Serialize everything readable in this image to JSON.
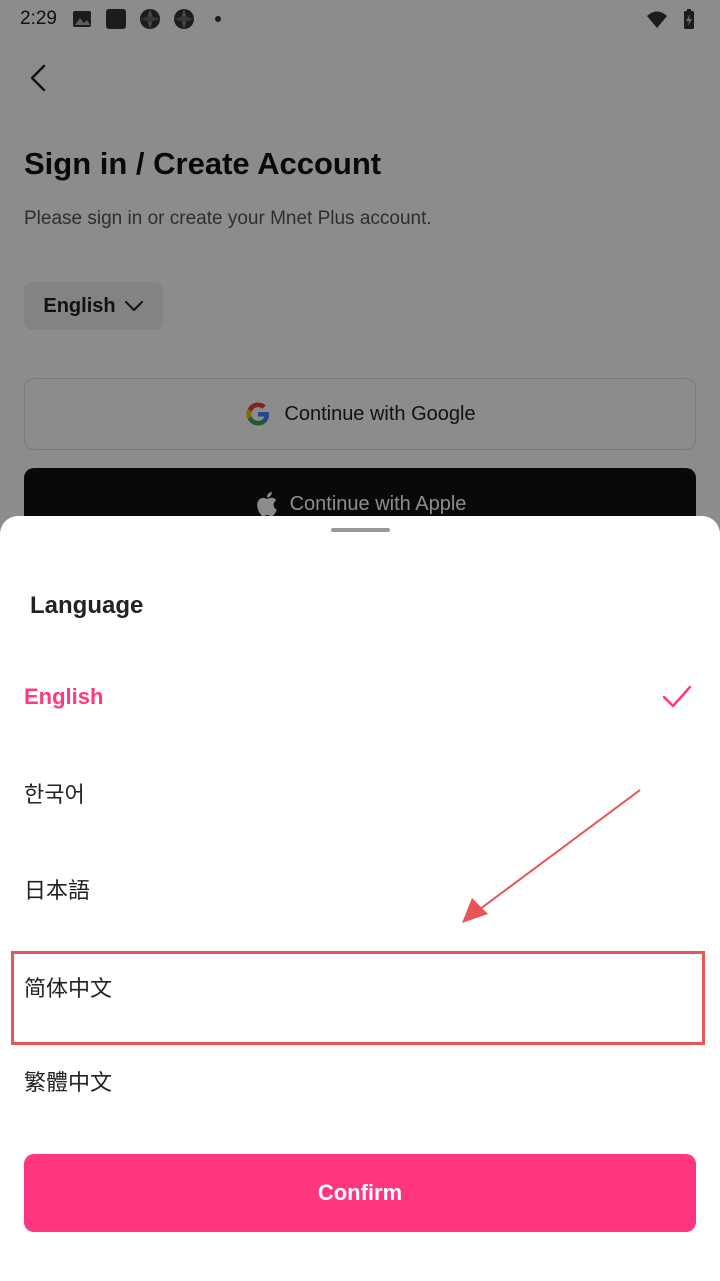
{
  "status_bar": {
    "time": "2:29",
    "left_icons": [
      "gallery-icon",
      "square-app-icon",
      "aperture-icon",
      "aperture-icon",
      "dot-icon"
    ],
    "right_icons": [
      "wifi-icon",
      "battery-charging-icon"
    ]
  },
  "background": {
    "back_icon": "chevron-left-icon",
    "title": "Sign in / Create Account",
    "subtitle": "Please sign in or create your Mnet Plus account.",
    "language_selector": "English",
    "google_button": "Continue with Google",
    "apple_button": "Continue with Apple"
  },
  "sheet": {
    "title": "Language",
    "options": [
      {
        "label": "English",
        "selected": true
      },
      {
        "label": "한국어",
        "selected": false
      },
      {
        "label": "日本語",
        "selected": false
      },
      {
        "label": "简体中文",
        "selected": false
      },
      {
        "label": "繁體中文",
        "selected": false
      }
    ],
    "confirm_label": "Confirm"
  },
  "colors": {
    "accent": "#ff3580",
    "selected_text": "#ff3a7c",
    "annotation": "#e85555"
  }
}
